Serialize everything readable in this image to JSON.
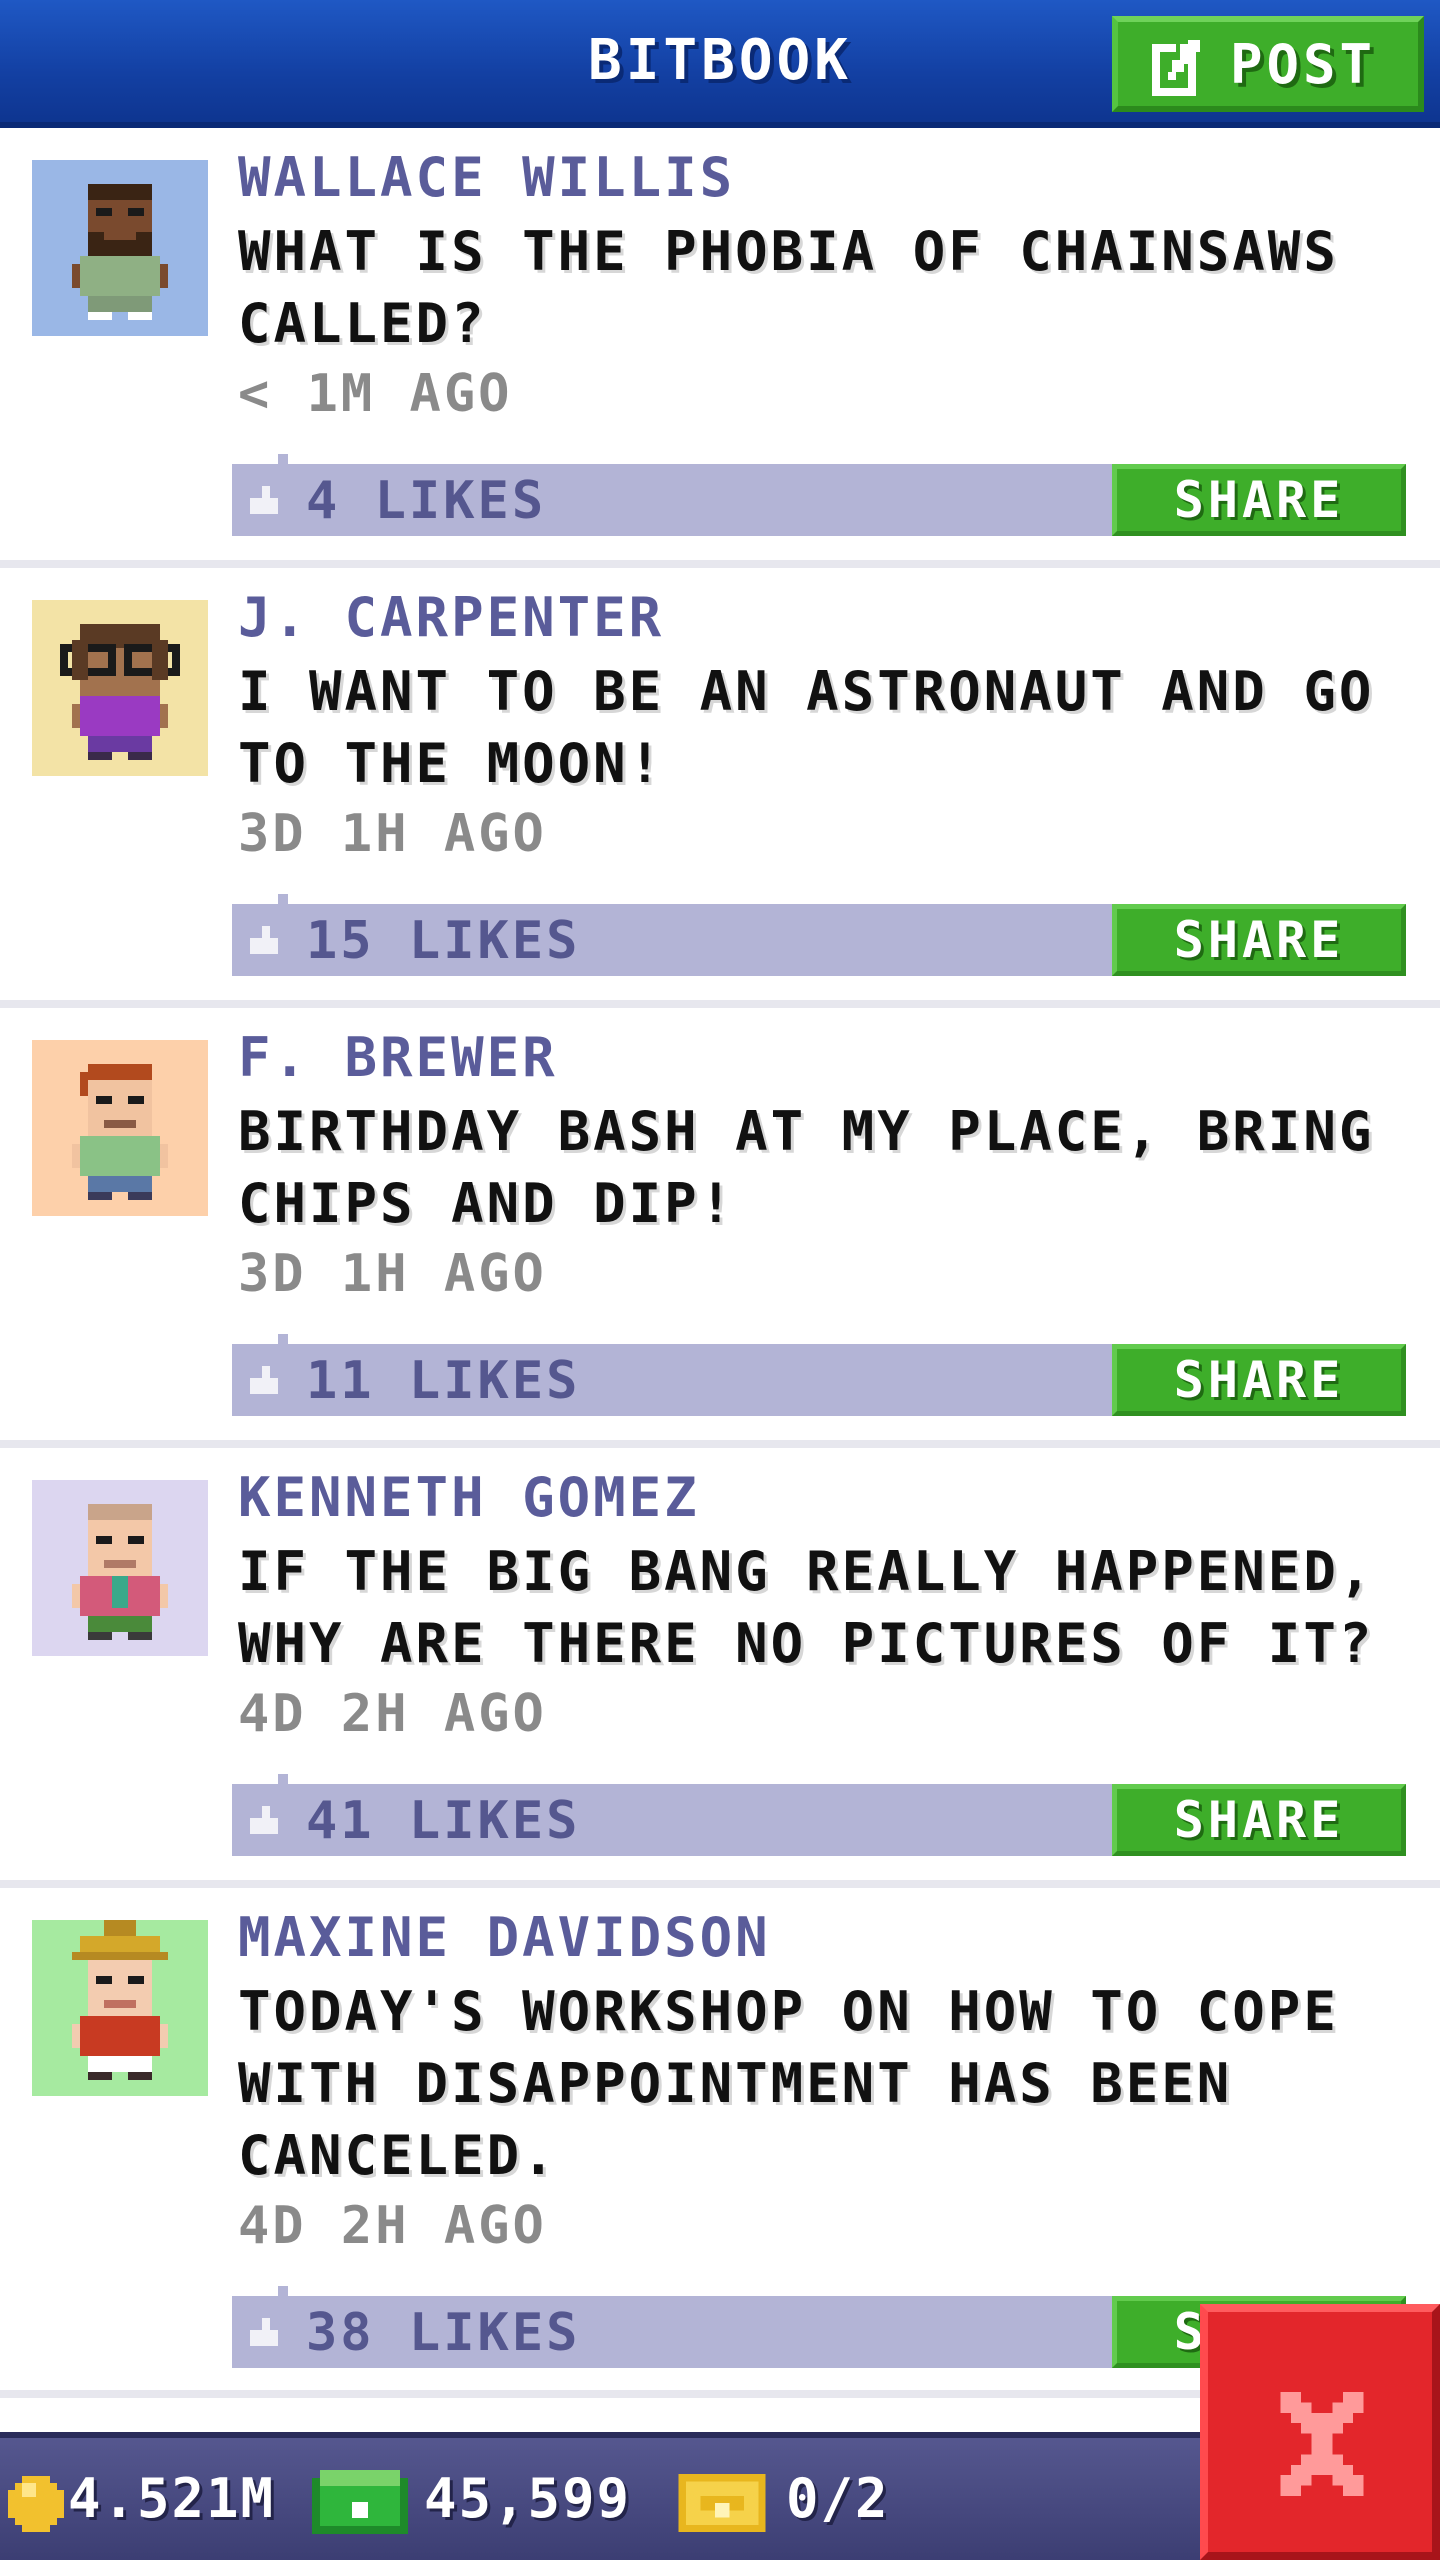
{
  "header": {
    "title": "BITBOOK",
    "post_label": "POST"
  },
  "posts": [
    {
      "author": "WALLACE WILLIS",
      "lines": [
        "WHAT IS THE PHOBIA OF CHAINSAWS",
        "CALLED?"
      ],
      "time": "< 1M AGO",
      "likes": "4 LIKES",
      "share": "SHARE",
      "avatar_bg": "#9ab7e6"
    },
    {
      "author": "J. CARPENTER",
      "lines": [
        "I WANT TO BE AN ASTRONAUT AND GO",
        "TO THE MOON!"
      ],
      "time": "3D 1H AGO",
      "likes": "15 LIKES",
      "share": "SHARE",
      "avatar_bg": "#f3e3a6"
    },
    {
      "author": "F. BREWER",
      "lines": [
        "BIRTHDAY BASH AT MY PLACE, BRING",
        "CHIPS AND DIP!"
      ],
      "time": "3D 1H AGO",
      "likes": "11 LIKES",
      "share": "SHARE",
      "avatar_bg": "#fdd0aa"
    },
    {
      "author": "KENNETH GOMEZ",
      "lines": [
        "IF THE BIG BANG REALLY HAPPENED,",
        "WHY ARE THERE NO PICTURES OF IT?"
      ],
      "time": "4D 2H AGO",
      "likes": "41 LIKES",
      "share": "SHARE",
      "avatar_bg": "#dcd6f0"
    },
    {
      "author": "MAXINE DAVIDSON",
      "lines": [
        "TODAY'S WORKSHOP ON HOW TO COPE",
        "WITH DISAPPOINTMENT HAS BEEN",
        "CANCELED."
      ],
      "time": "4D 2H AGO",
      "likes": "38 LIKES",
      "share": "SHARE",
      "avatar_bg": "#a6eaa0"
    }
  ],
  "status": {
    "coins": "4.521M",
    "bux": "45,599",
    "tickets": "0/2"
  },
  "colors": {
    "header_blue": "#1340a3",
    "button_green": "#3eae2a",
    "like_bar": "#b3b4d6",
    "author_purple": "#5a5c9a",
    "close_red": "#e3262b"
  }
}
